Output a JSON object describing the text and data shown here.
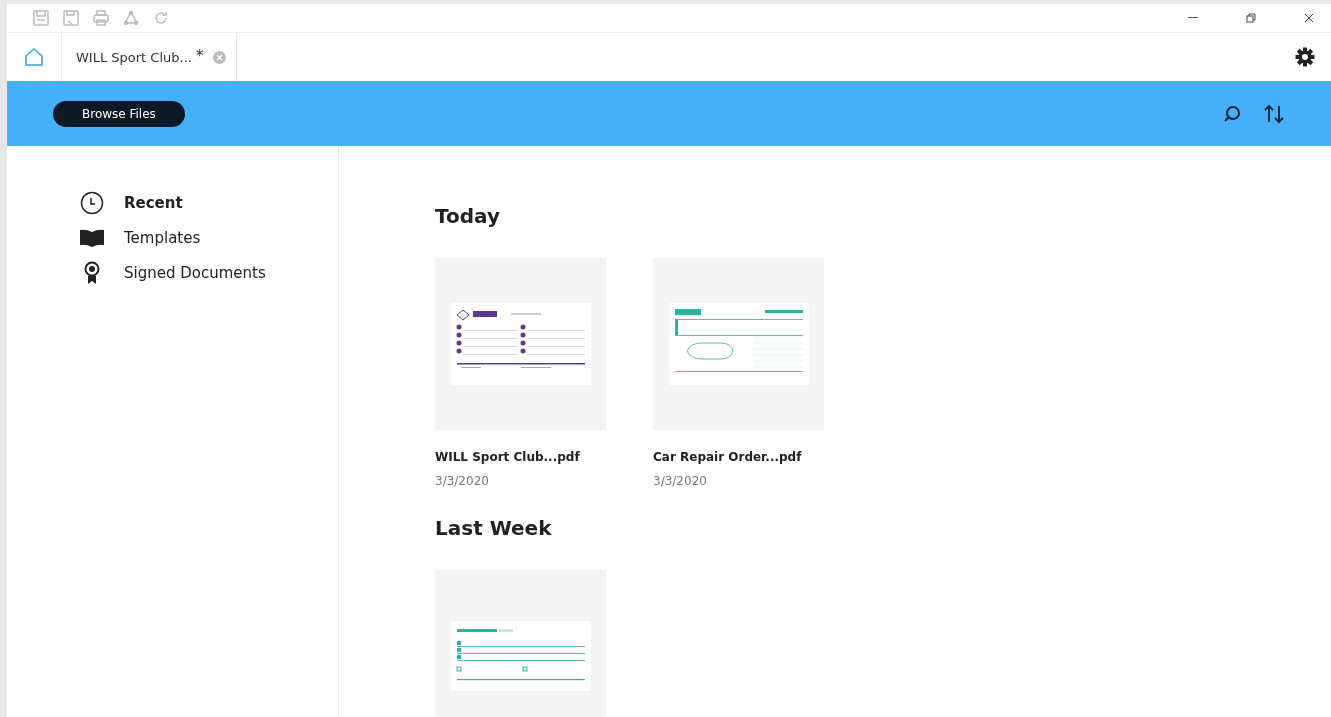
{
  "tab": {
    "label": "WILL Sport Club...",
    "modified_mark": "*"
  },
  "toolbar": {
    "browse_button": "Browse Files"
  },
  "sidebar": {
    "items": [
      {
        "label": "Recent",
        "kind": "clock",
        "selected": true
      },
      {
        "label": "Templates",
        "kind": "book",
        "selected": false
      },
      {
        "label": "Signed Documents",
        "kind": "badge",
        "selected": false
      }
    ]
  },
  "sections": [
    {
      "title": "Today",
      "files": [
        {
          "kind": "sports",
          "name": "WILL Sport Club...pdf",
          "date": "3/3/2020"
        },
        {
          "kind": "car",
          "name": "Car Repair Order...pdf",
          "date": "3/3/2020"
        }
      ]
    },
    {
      "title": "Last Week",
      "files": [
        {
          "kind": "form"
        }
      ]
    }
  ]
}
